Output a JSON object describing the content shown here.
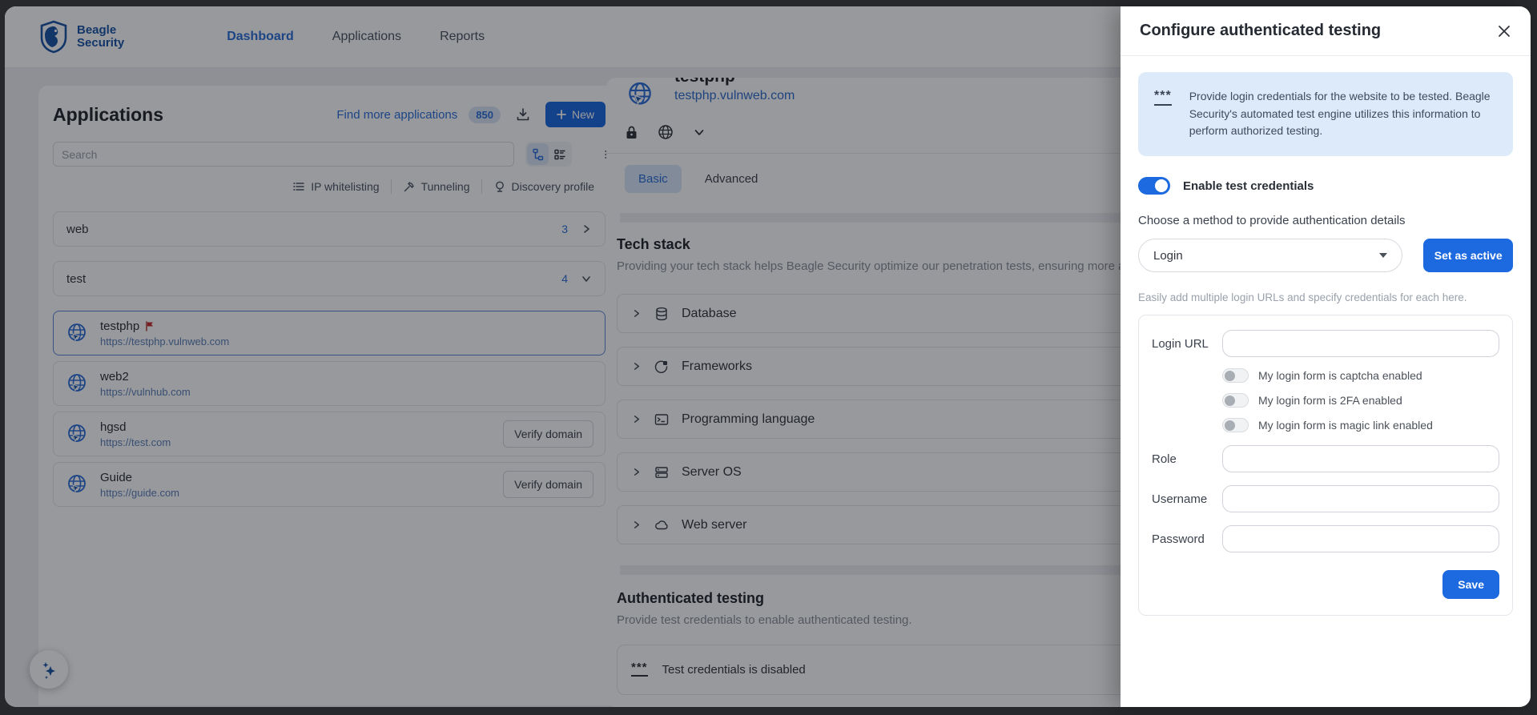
{
  "nav": {
    "brand_line1": "Beagle",
    "brand_line2": "Security",
    "items": [
      {
        "label": "Dashboard"
      },
      {
        "label": "Applications"
      },
      {
        "label": "Reports"
      }
    ]
  },
  "apps_panel": {
    "title": "Applications",
    "find_more_link": "Find more applications",
    "find_more_count": "850",
    "new_button": "New",
    "search": {
      "placeholder": "Search",
      "value": ""
    },
    "filters": [
      {
        "label": "IP whitelisting",
        "icon": "list-icon"
      },
      {
        "label": "Tunneling",
        "icon": "tunnel-icon"
      },
      {
        "label": "Discovery profile",
        "icon": "discovery-icon"
      }
    ],
    "groups": [
      {
        "name": "web",
        "count": "3",
        "state": "collapsed"
      },
      {
        "name": "test",
        "count": "4",
        "state": "expanded"
      }
    ],
    "apps": [
      {
        "name": "testphp",
        "url": "https://testphp.vulnweb.com",
        "flagged": true,
        "selected": true
      },
      {
        "name": "web2",
        "url": "https://vulnhub.com"
      },
      {
        "name": "hgsd",
        "url": "https://test.com",
        "verify_button": "Verify domain"
      },
      {
        "name": "Guide",
        "url": "https://guide.com",
        "verify_button": "Verify domain"
      }
    ]
  },
  "main": {
    "app_title_clipped": "testphp",
    "app_link": "testphp.vulnweb.com",
    "tabs": [
      {
        "label": "Basic",
        "active": true
      },
      {
        "label": "Advanced",
        "active": false
      }
    ],
    "tech_stack": {
      "title": "Tech stack",
      "description": "Providing your tech stack helps Beagle Security optimize our penetration tests, ensuring more acc",
      "items": [
        {
          "label": "Database",
          "icon": "database-icon"
        },
        {
          "label": "Frameworks",
          "icon": "frameworks-icon"
        },
        {
          "label": "Programming language",
          "icon": "terminal-icon"
        },
        {
          "label": "Server OS",
          "icon": "server-icon"
        },
        {
          "label": "Web server",
          "icon": "cloud-icon"
        }
      ]
    },
    "auth_testing": {
      "title": "Authenticated testing",
      "description": "Provide test credentials to enable authenticated testing.",
      "status": "Test credentials is disabled"
    }
  },
  "drawer": {
    "title": "Configure authenticated testing",
    "info_text": "Provide login credentials for the website to be tested. Beagle Security's automated test engine utilizes this information to perform authorized testing.",
    "enable_toggle_label": "Enable test credentials",
    "enable_toggle_state": "on",
    "method_label": "Choose a method to provide authentication details",
    "method_value": "Login",
    "set_active_button": "Set as active",
    "helper_text": "Easily add multiple login URLs and specify credentials for each here.",
    "form": {
      "login_url_label": "Login URL",
      "login_url_value": "",
      "toggles": [
        {
          "label": "My login form is captcha enabled",
          "state": "off"
        },
        {
          "label": "My login form is 2FA enabled",
          "state": "off"
        },
        {
          "label": "My login form is magic link enabled",
          "state": "off"
        }
      ],
      "role_label": "Role",
      "role_value": "",
      "username_label": "Username",
      "username_value": "",
      "password_label": "Password",
      "password_value": "",
      "save_button": "Save"
    }
  },
  "icons": {
    "password_dots": "***"
  },
  "colors": {
    "primary": "#1d6ae0",
    "link": "#2b6fd9",
    "logo": "#1a55a8",
    "info_bg": "#ddeafa",
    "page_bg": "#eef0f4"
  }
}
